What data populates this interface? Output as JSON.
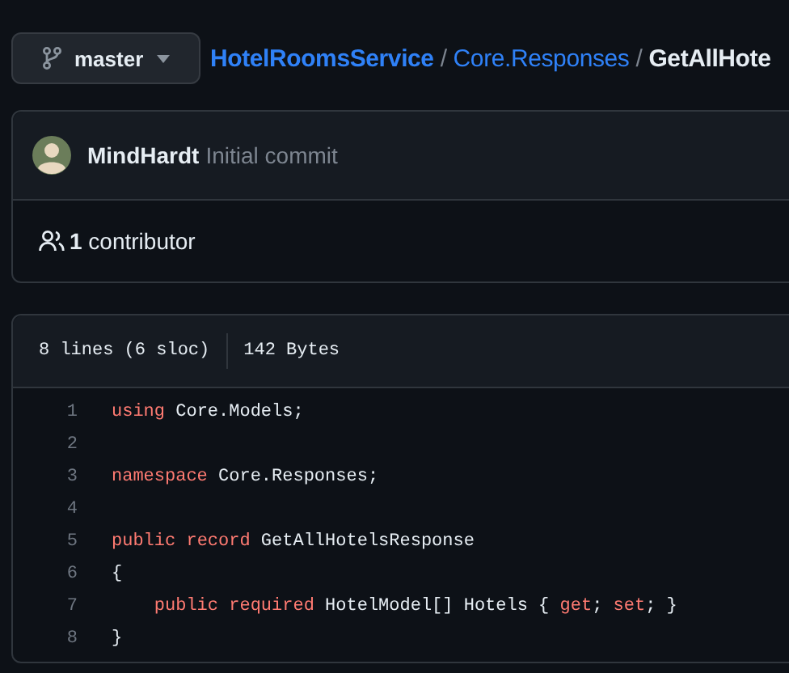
{
  "branch_button": {
    "label": "master"
  },
  "breadcrumb": [
    {
      "text": "HotelRoomsService",
      "kind": "link"
    },
    {
      "text": "/",
      "kind": "separator"
    },
    {
      "text": "Core.Responses",
      "kind": "link"
    },
    {
      "text": "/",
      "kind": "separator"
    },
    {
      "text": "GetAllHote",
      "kind": "current"
    }
  ],
  "commit": {
    "author": "MindHardt",
    "message": "Initial commit"
  },
  "contributors": {
    "count": "1",
    "label": "contributor"
  },
  "file_info": {
    "lines": "8 lines (6 sloc)",
    "size": "142 Bytes"
  },
  "code_lines": [
    {
      "number": "1",
      "tokens": [
        {
          "text": "using",
          "kind": "keyword"
        },
        {
          "text": " Core.Models;",
          "kind": "plain"
        }
      ]
    },
    {
      "number": "2"
    },
    {
      "number": "3",
      "tokens": [
        {
          "text": "namespace",
          "kind": "keyword"
        },
        {
          "text": " Core.Responses;",
          "kind": "plain"
        }
      ]
    },
    {
      "number": "4"
    },
    {
      "number": "5",
      "tokens": [
        {
          "text": "public ",
          "kind": "keyword"
        },
        {
          "text": "record",
          "kind": "keyword"
        },
        {
          "text": " GetAllHotelsResponse",
          "kind": "plain"
        }
      ]
    },
    {
      "number": "6",
      "tokens": [
        {
          "text": "{",
          "kind": "plain"
        }
      ]
    },
    {
      "number": "7",
      "tokens": [
        {
          "text": "    public ",
          "kind": "keyword"
        },
        {
          "text": "required",
          "kind": "keyword"
        },
        {
          "text": " HotelModel[] Hotels { ",
          "kind": "plain"
        },
        {
          "text": "get",
          "kind": "keyword"
        },
        {
          "text": "; ",
          "kind": "plain"
        },
        {
          "text": "set",
          "kind": "keyword"
        },
        {
          "text": "; }",
          "kind": "plain"
        }
      ]
    },
    {
      "number": "8",
      "tokens": [
        {
          "text": "}",
          "kind": "plain"
        }
      ]
    }
  ]
}
